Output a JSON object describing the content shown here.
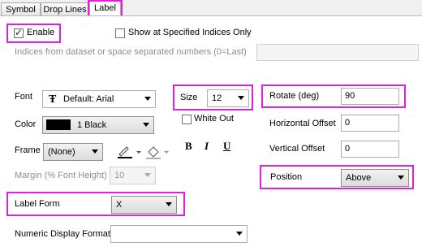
{
  "tabs": [
    "Symbol",
    "Drop Lines",
    "Label"
  ],
  "enable": {
    "label": "Enable",
    "checked": true
  },
  "show_indices": {
    "label": "Show at Specified Indices Only",
    "checked": false
  },
  "indices_hint": "Indices from dataset or space separated numbers (0=Last)",
  "font": {
    "label": "Font",
    "value": "Default: Arial",
    "icon": "truetype-font-icon"
  },
  "color": {
    "label": "Color",
    "value": "1 Black",
    "swatch": "#000000"
  },
  "frame": {
    "label": "Frame",
    "value": "(None)"
  },
  "margin": {
    "label": "Margin (% Font Height)",
    "value": "10"
  },
  "size": {
    "label": "Size",
    "value": "12"
  },
  "white_out": {
    "label": "White Out",
    "checked": false
  },
  "style_buttons": {
    "bold": "B",
    "italic": "I",
    "underline": "U"
  },
  "rotate": {
    "label": "Rotate (deg)",
    "value": "90"
  },
  "h_offset": {
    "label": "Horizontal Offset",
    "value": "0"
  },
  "v_offset": {
    "label": "Vertical Offset",
    "value": "0"
  },
  "position": {
    "label": "Position",
    "value": "Above"
  },
  "label_form": {
    "label": "Label Form",
    "value": "X"
  },
  "numeric_format": {
    "label": "Numeric Display Format",
    "value": ""
  },
  "highlight_color": "#e020e0"
}
